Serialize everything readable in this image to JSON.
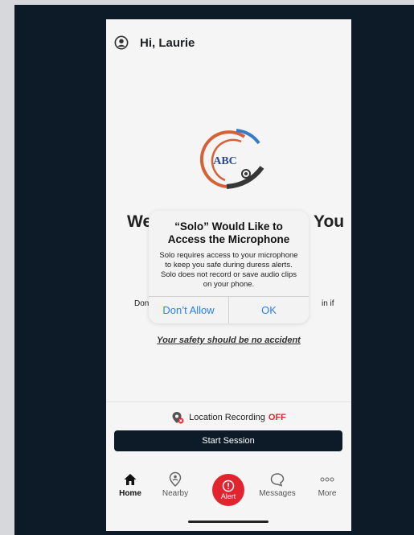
{
  "header": {
    "greeting": "Hi, Laurie"
  },
  "logo": {
    "text": "ABC"
  },
  "background": {
    "welcome_left": "We",
    "welcome_right": "You",
    "line_left": "Don",
    "line_right": "in if",
    "tagline": "Your safety should be no accident"
  },
  "permission_dialog": {
    "title": "“Solo” Would Like to Access the Microphone",
    "message": "Solo requires access to your microphone to keep you safe during duress alerts. Solo does not record or save audio clips on your phone.",
    "deny_label": "Don’t Allow",
    "ok_label": "OK"
  },
  "location": {
    "label": "Location Recording",
    "status": "OFF"
  },
  "start_session": {
    "label": "Start Session"
  },
  "nav": {
    "home": "Home",
    "nearby": "Nearby",
    "alert": "Alert",
    "messages": "Messages",
    "more": "More"
  },
  "colors": {
    "accent_red": "#e2242e",
    "navy": "#0d1b29",
    "ios_blue": "#2a7ff5"
  }
}
